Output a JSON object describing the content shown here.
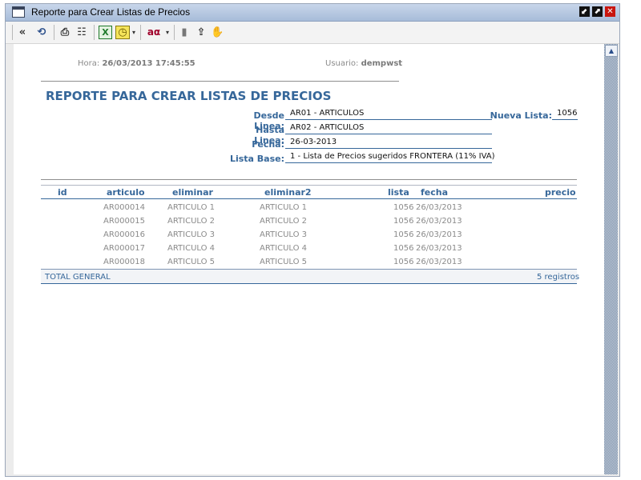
{
  "window": {
    "title": "Reporte para Crear Listas de Precios",
    "buttons": [
      "⬋",
      "⬈",
      "✕"
    ]
  },
  "toolbar": {
    "icons": [
      {
        "name": "back-icon",
        "glyph": "«"
      },
      {
        "name": "refresh-icon",
        "glyph": "⟲"
      },
      {
        "name": "print-icon",
        "glyph": "⎙"
      },
      {
        "name": "columns-icon",
        "glyph": "☷"
      },
      {
        "name": "excel-icon",
        "glyph": "X",
        "color": "#1f7a2b"
      },
      {
        "name": "schedule-icon",
        "glyph": "◷",
        "color": "#d8a800"
      },
      {
        "name": "font-icon",
        "glyph": "aα",
        "color": "#a0002a"
      },
      {
        "name": "clipboard-icon",
        "glyph": "▮"
      },
      {
        "name": "export-icon",
        "glyph": "⇪"
      },
      {
        "name": "hand-icon",
        "glyph": "✋"
      }
    ]
  },
  "header": {
    "hora_label": "Hora:",
    "hora_value": "26/03/2013 17:45:55",
    "usuario_label": "Usuario:",
    "usuario_value": "dempwst"
  },
  "report": {
    "title": "REPORTE PARA CREAR LISTAS DE PRECIOS",
    "params": {
      "desde_label": "Desde Linea:",
      "desde_value": "AR01 - ARTICULOS",
      "hasta_label": "Hasta Linea:",
      "hasta_value": "AR02 - ARTICULOS",
      "fecha_label": "Fecha:",
      "fecha_value": "26-03-2013",
      "base_label": "Lista Base:",
      "base_value": "1 - Lista de Precios sugeridos FRONTERA (11% IVA)",
      "nueva_label": "Nueva Lista:",
      "nueva_value": "1056"
    },
    "columns": [
      "id",
      "articulo",
      "eliminar",
      "eliminar2",
      "lista",
      "fecha",
      "precio"
    ],
    "rows": [
      {
        "articulo": "AR000014",
        "eliminar": "ARTICULO 1",
        "eliminar2": "ARTICULO 1",
        "lista": "1056",
        "fecha": "26/03/2013"
      },
      {
        "articulo": "AR000015",
        "eliminar": "ARTICULO 2",
        "eliminar2": "ARTICULO 2",
        "lista": "1056",
        "fecha": "26/03/2013"
      },
      {
        "articulo": "AR000016",
        "eliminar": "ARTICULO 3",
        "eliminar2": "ARTICULO 3",
        "lista": "1056",
        "fecha": "26/03/2013"
      },
      {
        "articulo": "AR000017",
        "eliminar": "ARTICULO 4",
        "eliminar2": "ARTICULO 4",
        "lista": "1056",
        "fecha": "26/03/2013"
      },
      {
        "articulo": "AR000018",
        "eliminar": "ARTICULO 5",
        "eliminar2": "ARTICULO 5",
        "lista": "1056",
        "fecha": "26/03/2013"
      }
    ],
    "total_label": "TOTAL GENERAL",
    "total_count": "5 registros"
  },
  "scrollbar": {
    "up_glyph": "▲"
  }
}
